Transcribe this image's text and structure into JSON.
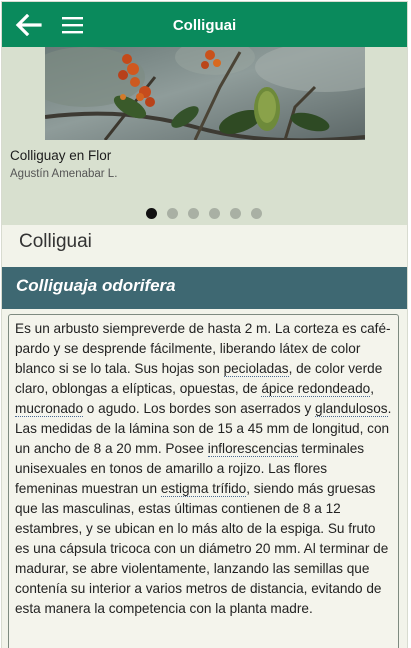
{
  "header": {
    "title": "Colliguai",
    "back_icon": "arrow-left-icon",
    "menu_icon": "hamburger-menu-icon"
  },
  "gallery": {
    "caption": "Colliguay en Flor",
    "credit": "Agustín Amenabar L.",
    "slide_count": 6,
    "active_index": 0
  },
  "species": {
    "common_name": "Colliguai",
    "scientific_name": "Colliguaja odorifera"
  },
  "description": {
    "s1": "Es un arbusto siempreverde de hasta 2 m. La corteza es café-pardo y se desprende fácilmente, liberando látex de color blanco si se lo tala. Sus hojas son ",
    "t1": "pecioladas",
    "s2": ", de color verde claro, oblongas a elípticas, opuestas, de ",
    "t2": "ápice redondeado",
    "s3": ", ",
    "t3": "mucronado",
    "s4": " o agudo. Los bordes son aserrados y ",
    "t4": "glandulosos",
    "s5": ". Las medidas de la lámina son de 15 a 45 mm de longitud, con un ancho de 8 a 20 mm. Posee ",
    "t5": "inflorescencias",
    "s6": " terminales unisexuales en tonos de amarillo a rojizo. Las flores femeninas muestran un ",
    "t6": "estigma trífido",
    "s7": ", siendo más gruesas que las masculinas, estas últimas contienen de 8 a 12 estambres, y se ubican en lo más alto de la espiga. Su fruto es una cápsula tricoca con un diámetro 20 mm. Al terminar de madurar, se abre violentamente, lanzando las semillas que contenía su interior a varios metros de distancia, evitando de esta manera la competencia con la planta madre."
  },
  "colors": {
    "header_bg": "#0a8a5c",
    "scientific_bar_bg": "#3e6872",
    "page_bg": "#f2f3ea"
  }
}
